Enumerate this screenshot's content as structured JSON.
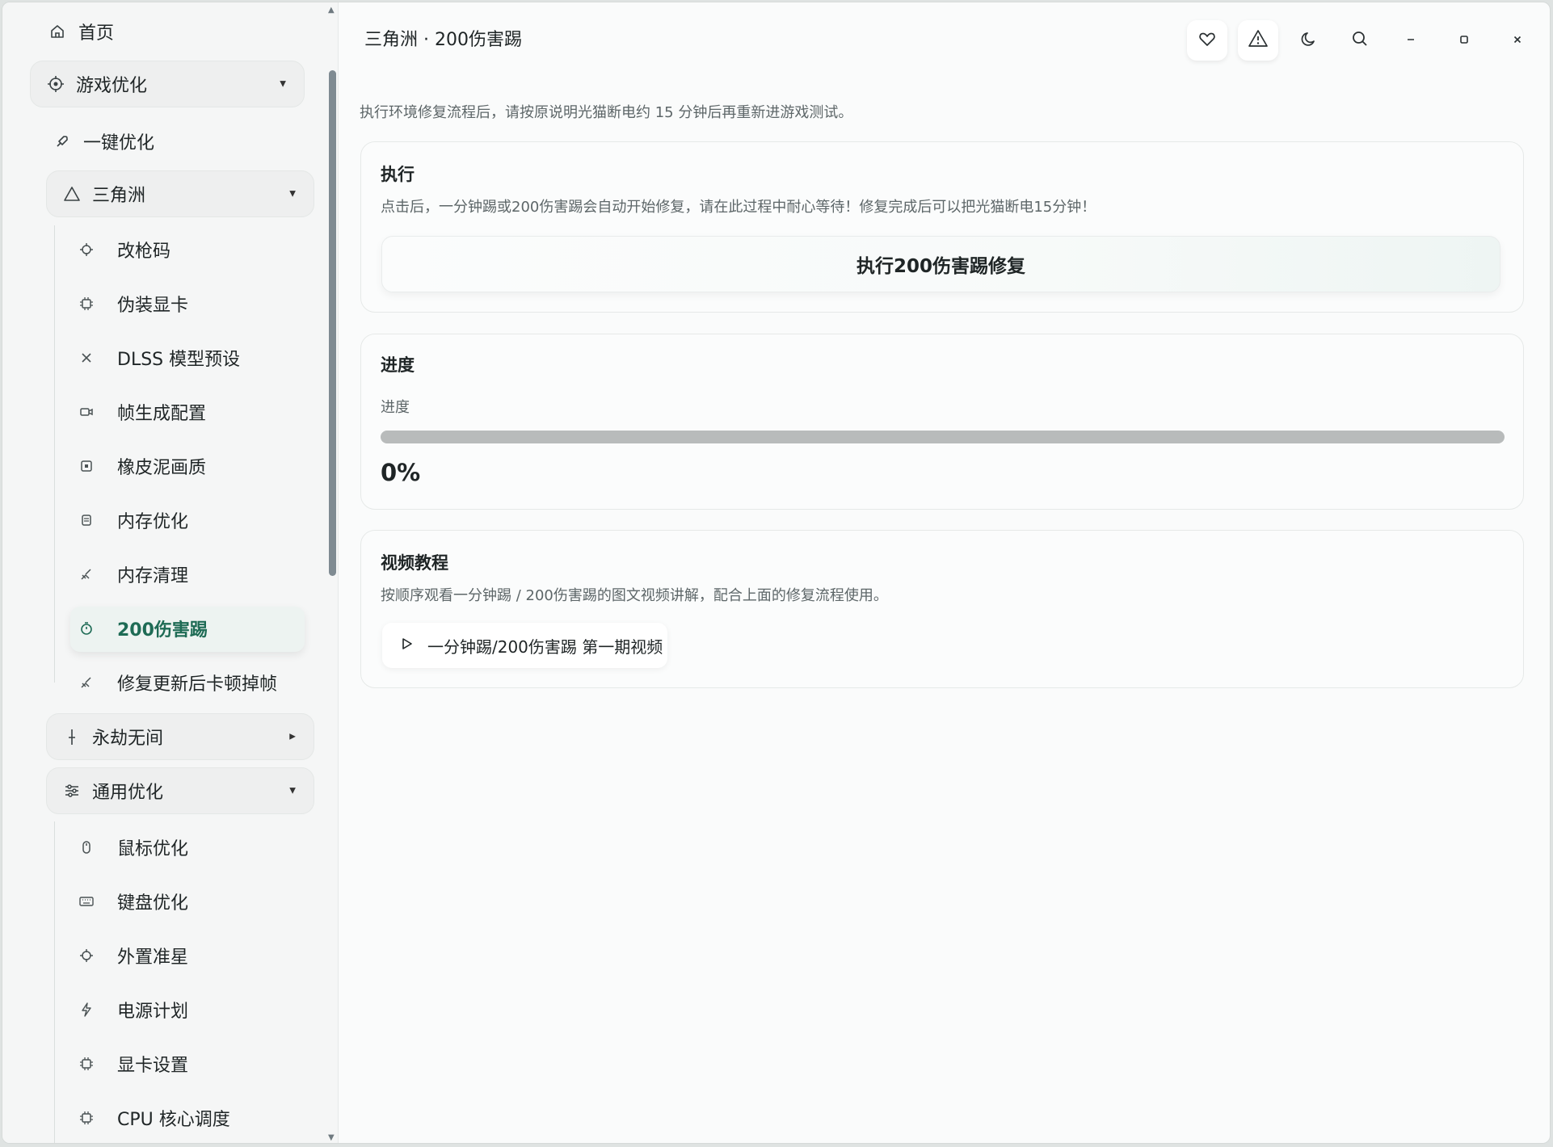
{
  "window": {
    "title": "三角洲 · 200伤害踢"
  },
  "progress_value": 0,
  "sidebar": {
    "home": "首页",
    "game_opt": "游戏优化",
    "one_click": "一键优化",
    "delta": "三角洲",
    "delta_items": [
      "改枪码",
      "伪装显卡",
      "DLSS 模型预设",
      "帧生成配置",
      "橡皮泥画质",
      "内存优化",
      "内存清理",
      "200伤害踢",
      "修复更新后卡顿掉帧"
    ],
    "yongjie": "永劫无间",
    "general": "通用优化",
    "general_items": [
      "鼠标优化",
      "键盘优化",
      "外置准星",
      "电源计划",
      "显卡设置",
      "CPU 核心调度"
    ]
  },
  "main": {
    "description": "执行环境修复流程后，请按原说明光猫断电约 15 分钟后再重新进游戏测试。",
    "exec_card": {
      "title": "执行",
      "desc": "点击后，一分钟踢或200伤害踢会自动开始修复，请在此过程中耐心等待！修复完成后可以把光猫断电15分钟！",
      "button": "执行200伤害踢修复"
    },
    "progress_card": {
      "title": "进度",
      "label": "进度",
      "percent_text": "0%"
    },
    "video_card": {
      "title": "视频教程",
      "desc": "按顺序观看一分钟踢 / 200伤害踢的图文视频讲解，配合上面的修复流程使用。",
      "button": "一分钟踢/200伤害踢 第一期视频"
    }
  },
  "colors": {
    "accent": "#2f7d68",
    "active_text": "#1e6b55",
    "progress_track": "#b8bbbb"
  }
}
